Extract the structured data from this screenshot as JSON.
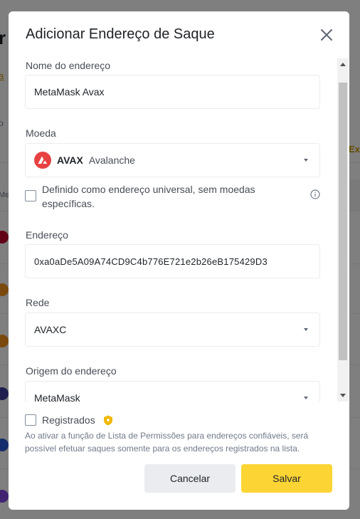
{
  "background": {
    "title_fragment": "r",
    "link_fragment": "a",
    "header_fragment": "o",
    "column_fragment": "Me",
    "right_fragment": "Ex"
  },
  "modal": {
    "title": "Adicionar Endereço de Saque",
    "close_icon": "close-icon"
  },
  "form": {
    "address_name": {
      "label": "Nome do endereço",
      "value": "MetaMask Avax"
    },
    "currency": {
      "label": "Moeda",
      "symbol": "AVAX",
      "name": "Avalanche",
      "icon_color": "#e84142"
    },
    "universal": {
      "label": "Definido como endereço universal, sem moedas específicas.",
      "checked": false
    },
    "address": {
      "label": "Endereço",
      "value": "0xa0aDe5A09A74CD9C4b776E721e2b26eB175429D3"
    },
    "network": {
      "label": "Rede",
      "value": "AVAXC"
    },
    "origin": {
      "label": "Origem do endereço",
      "value": "MetaMask"
    }
  },
  "registered": {
    "label": "Registrados",
    "checked": false,
    "note": "Ao ativar a função de Lista de Permissões para endereços confiáveis, será possível efetuar saques somente para os endereços registrados na lista."
  },
  "buttons": {
    "cancel": "Cancelar",
    "save": "Salvar"
  },
  "colors": {
    "accent": "#fcd535",
    "secondary_button": "#eaecef",
    "badge": "#f0b90b"
  }
}
